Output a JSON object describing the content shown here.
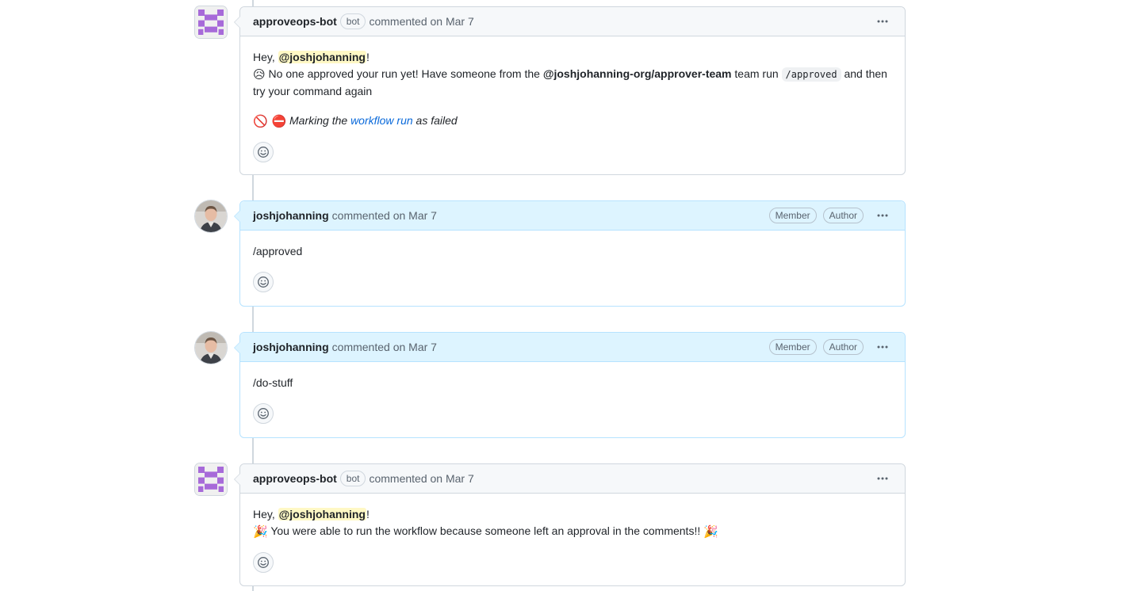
{
  "comments": [
    {
      "author": "approveops-bot",
      "bot_label": "bot",
      "meta": "commented on Mar 7",
      "greeting_prefix": "Hey, ",
      "mention": "@joshjohanning",
      "greeting_suffix": "!",
      "line2_emoji": "😥",
      "line2_text_a": " No one approved your run yet! Have someone from the ",
      "team": "@joshjohanning-org/approver-team",
      "line2_text_b": " team run ",
      "code": "/approved",
      "line2_text_c": " and then try your command again",
      "line3_emojis": "🚫 ⛔",
      "line3_italic_a": " Marking the ",
      "line3_link": "workflow run",
      "line3_italic_b": " as failed",
      "icons": {
        "avatar": "identicon-icon",
        "menu": "kebab-horizontal-icon",
        "reaction": "smiley-icon"
      }
    },
    {
      "author": "joshjohanning",
      "meta": "commented on Mar 7",
      "badges": [
        "Member",
        "Author"
      ],
      "body": "/approved"
    },
    {
      "author": "joshjohanning",
      "meta": "commented on Mar 7",
      "badges": [
        "Member",
        "Author"
      ],
      "body": "/do-stuff"
    },
    {
      "author": "approveops-bot",
      "bot_label": "bot",
      "meta": "commented on Mar 7",
      "greeting_prefix": "Hey, ",
      "mention": "@joshjohanning",
      "greeting_suffix": "!",
      "line2_emoji_start": "🎉",
      "line2_text": " You were able to run the workflow because someone left an approval in the comments!! ",
      "line2_emoji_end": "🎉"
    }
  ],
  "colors": {
    "accent_link": "#0969da",
    "author_header_bg": "#ddf4ff",
    "author_border": "#b6e3ff",
    "mention_bg": "#fff8c5",
    "identicon": "#a76ad9"
  }
}
